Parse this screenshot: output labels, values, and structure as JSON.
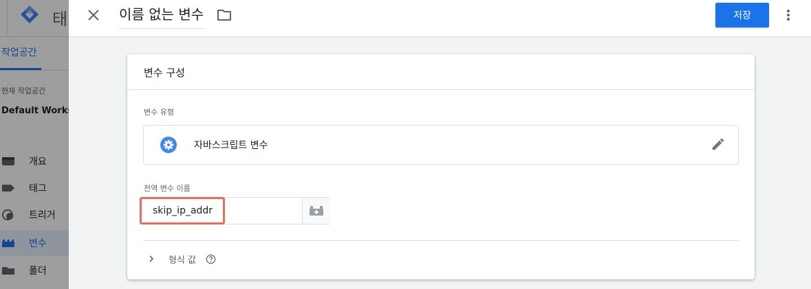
{
  "app": {
    "title_partial": "태"
  },
  "sidebar": {
    "tab_label": "작업공간",
    "workspace_label": "현재 작업공간",
    "workspace_name": "Default Workspace",
    "items": [
      {
        "label": "개요",
        "icon": "overview-icon"
      },
      {
        "label": "태그",
        "icon": "tag-icon"
      },
      {
        "label": "트리거",
        "icon": "trigger-icon"
      },
      {
        "label": "변수",
        "icon": "variable-icon",
        "active": true
      },
      {
        "label": "폴더",
        "icon": "folder-icon"
      }
    ]
  },
  "topbar": {
    "title": "이름 없는 변수",
    "save_label": "저장"
  },
  "card": {
    "title": "변수 구성",
    "variable_type_label": "변수 유형",
    "variable_type_name": "자바스크립트 변수",
    "global_name_label": "전역 변수 이름",
    "global_name_value": "skip_ip_addr",
    "format_value_label": "형식 값"
  },
  "colors": {
    "accent": "#1a73e8",
    "highlight": "#ee6b5a"
  }
}
